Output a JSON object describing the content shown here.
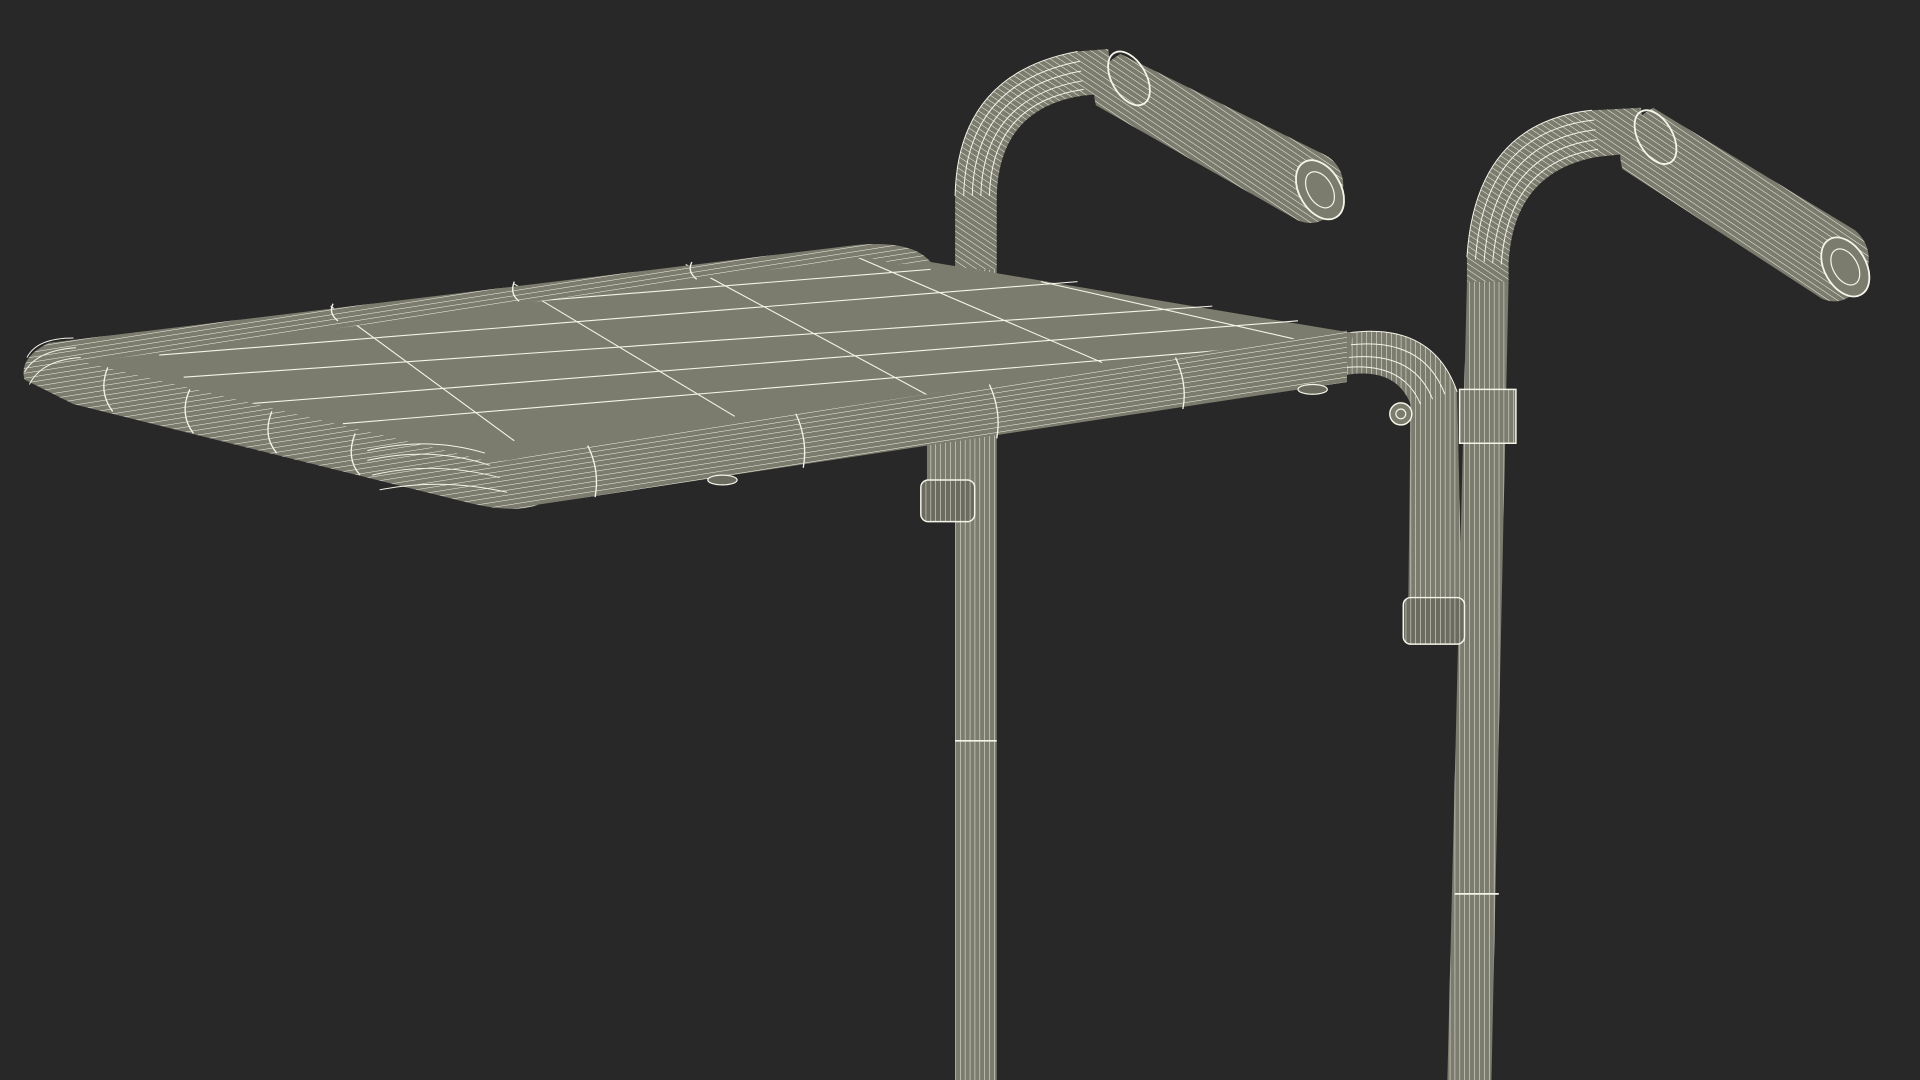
{
  "scene": {
    "subject": "walker-tray-wireframe",
    "colors": {
      "background": "#282828",
      "surface": "#7b7b6e",
      "surface_dark": "#6b6b60",
      "wire": "#f4f4e8"
    }
  }
}
